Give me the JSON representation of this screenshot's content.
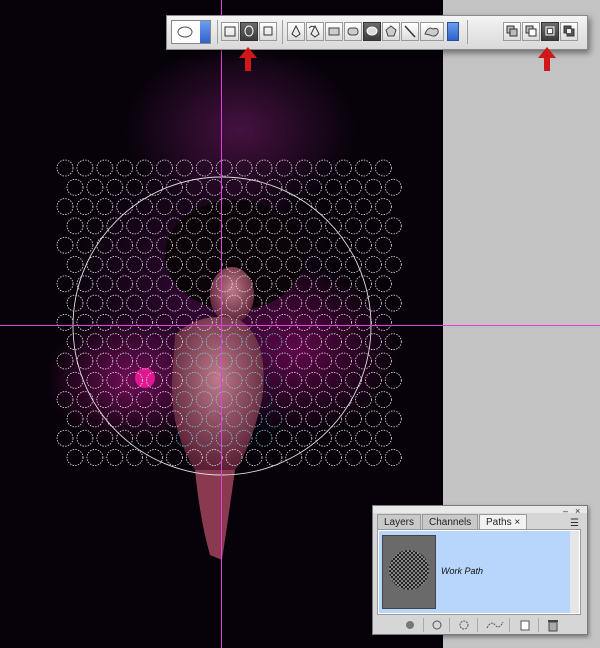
{
  "colors": {
    "guide": "#e040e0",
    "accent": "#2f62c8",
    "arrow": "#d01818",
    "selection": "#b8d6fb"
  },
  "options_bar": {
    "preset_icon": "ellipse-preset-icon",
    "mode_buttons": [
      "shape-layers-icon",
      "paths-icon",
      "fill-pixels-icon"
    ],
    "tool_buttons": [
      "pen-icon",
      "freeform-pen-icon",
      "rectangle-icon",
      "rounded-rectangle-icon",
      "ellipse-icon",
      "polygon-icon",
      "line-icon",
      "custom-shape-icon"
    ],
    "path_ops": [
      "add-to-path-icon",
      "subtract-from-path-icon",
      "intersect-path-icon",
      "exclude-overlap-icon"
    ]
  },
  "paths_panel": {
    "tabs": [
      "Layers",
      "Channels",
      "Paths"
    ],
    "active_tab": "Paths",
    "tab_close": "×",
    "path_name": "Work Path",
    "footer_icons": [
      "fill-path-icon",
      "stroke-path-icon",
      "load-selection-icon",
      "make-work-path-icon",
      "new-path-icon",
      "delete-path-icon"
    ]
  }
}
